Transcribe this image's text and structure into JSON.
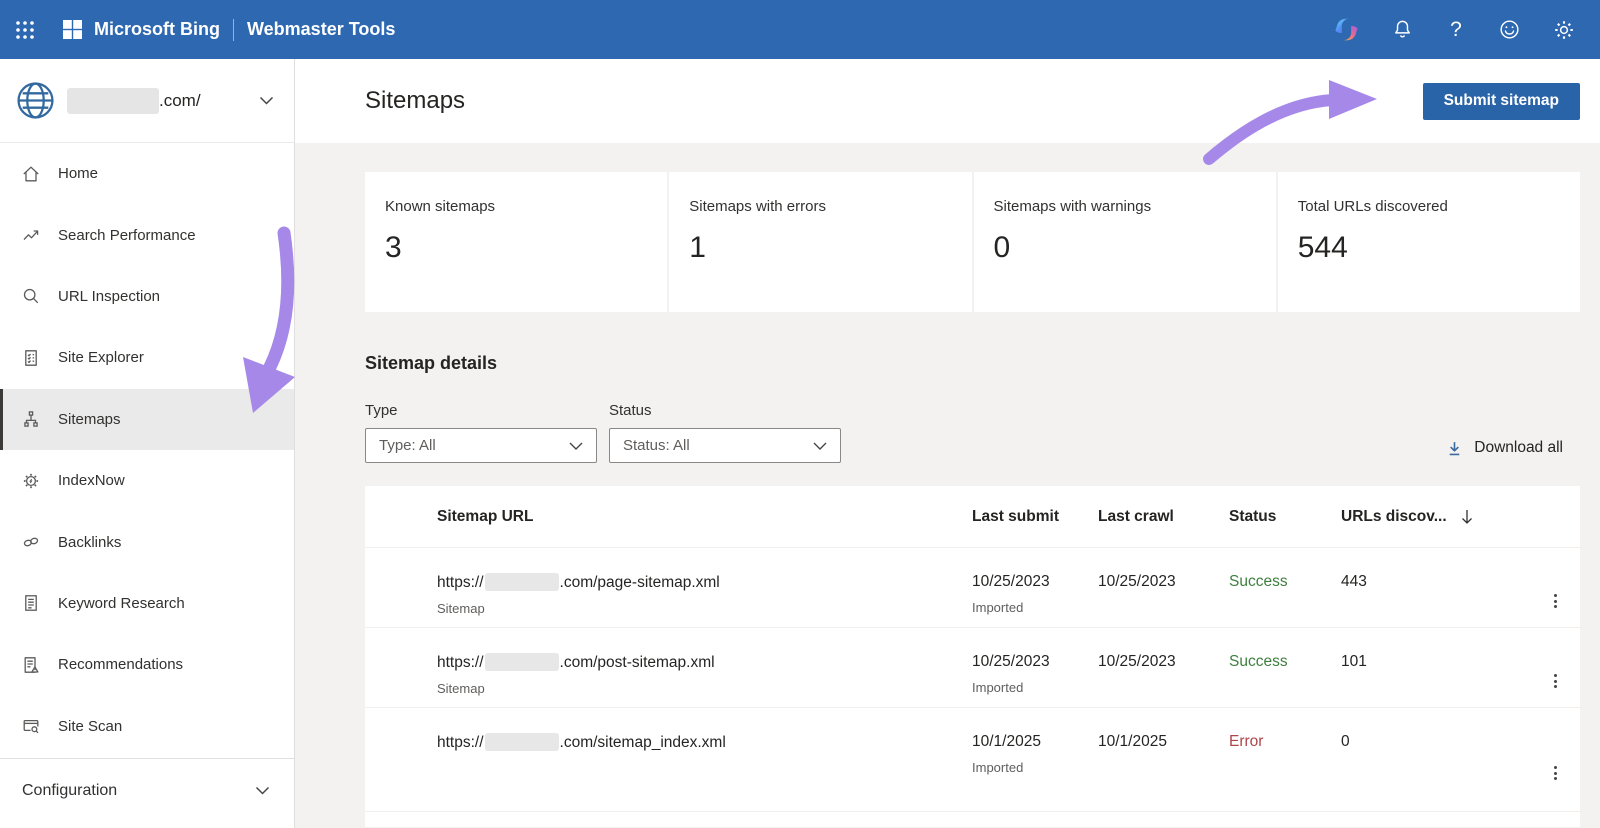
{
  "topbar": {
    "brand": "Microsoft Bing",
    "product": "Webmaster Tools",
    "icons": [
      "waffle-icon",
      "microsoft-logo",
      "copilot-icon",
      "bell-icon",
      "help-icon",
      "feedback-smiley-icon",
      "settings-gear-icon"
    ]
  },
  "sidebar": {
    "site_redacted": true,
    "site_suffix": ".com/",
    "items": [
      {
        "label": "Home",
        "icon": "home-icon",
        "selected": false
      },
      {
        "label": "Search Performance",
        "icon": "trend-arrow-icon",
        "selected": false
      },
      {
        "label": "URL Inspection",
        "icon": "magnifier-icon",
        "selected": false
      },
      {
        "label": "Site Explorer",
        "icon": "checklist-doc-icon",
        "selected": false
      },
      {
        "label": "Sitemaps",
        "icon": "hierarchy-icon",
        "selected": true
      },
      {
        "label": "IndexNow",
        "icon": "gear-bolt-icon",
        "selected": false
      },
      {
        "label": "Backlinks",
        "icon": "chain-links-icon",
        "selected": false
      },
      {
        "label": "Keyword Research",
        "icon": "lines-doc-icon",
        "selected": false
      },
      {
        "label": "Recommendations",
        "icon": "doc-warning-icon",
        "selected": false
      },
      {
        "label": "Site Scan",
        "icon": "browser-scan-icon",
        "selected": false
      }
    ],
    "footer_label": "Configuration"
  },
  "header": {
    "title": "Sitemaps",
    "submit_label": "Submit sitemap"
  },
  "stats": [
    {
      "label": "Known sitemaps",
      "value": "3"
    },
    {
      "label": "Sitemaps with errors",
      "value": "1"
    },
    {
      "label": "Sitemaps with warnings",
      "value": "0"
    },
    {
      "label": "Total URLs discovered",
      "value": "544"
    }
  ],
  "details": {
    "heading": "Sitemap details",
    "type_label": "Type",
    "type_value": "Type: All",
    "status_label": "Status",
    "status_value": "Status: All",
    "download_label": "Download all"
  },
  "table": {
    "columns": [
      "Sitemap URL",
      "Last submit",
      "Last crawl",
      "Status",
      "URLs discov..."
    ],
    "rows": [
      {
        "url_prefix": "https://",
        "url_redacted": true,
        "url_suffix": ".com/page-sitemap.xml",
        "type_label": "Sitemap",
        "last_submit": "10/25/2023",
        "submit_note": "Imported",
        "last_crawl": "10/25/2023",
        "status": "Success",
        "status_color": "#3f7e3f",
        "urls_discovered": "443"
      },
      {
        "url_prefix": "https://",
        "url_redacted": true,
        "url_suffix": ".com/post-sitemap.xml",
        "type_label": "Sitemap",
        "last_submit": "10/25/2023",
        "submit_note": "Imported",
        "last_crawl": "10/25/2023",
        "status": "Success",
        "status_color": "#3f7e3f",
        "urls_discovered": "101"
      },
      {
        "url_prefix": "https://",
        "url_redacted": true,
        "url_suffix": ".com/sitemap_index.xml",
        "type_label": "",
        "last_submit": "10/1/2025",
        "submit_note": "Imported",
        "last_crawl": "10/1/2025",
        "status": "Error",
        "status_color": "#ae4549",
        "urls_discovered": "0"
      }
    ]
  },
  "colors": {
    "topbar_blue": "#2d68b1",
    "primary_button_blue": "#2a64a8",
    "success_green": "#3f7e3f",
    "error_red": "#ae4549",
    "annotation_purple": "#a688e8",
    "selected_nav_gray": "#eaeaea"
  }
}
